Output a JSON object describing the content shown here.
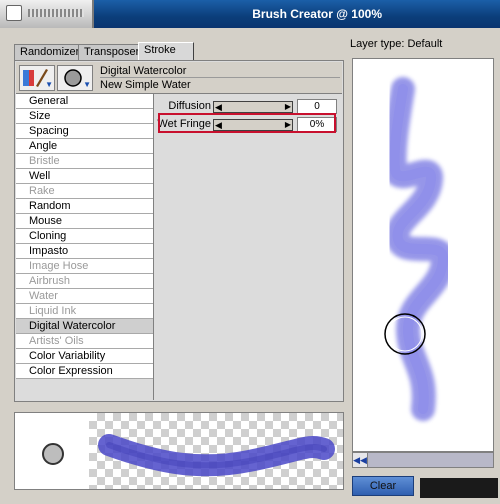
{
  "window": {
    "title": "Brush Creator @ 100%"
  },
  "tabs": [
    {
      "label": "Randomizer"
    },
    {
      "label": "Transposer"
    },
    {
      "label": "Stroke Designer"
    }
  ],
  "brush": {
    "category": "Digital Watercolor",
    "variant": "New Simple Water"
  },
  "categories": [
    {
      "label": "General"
    },
    {
      "label": "Size"
    },
    {
      "label": "Spacing"
    },
    {
      "label": "Angle"
    },
    {
      "label": "Bristle"
    },
    {
      "label": "Well"
    },
    {
      "label": "Rake"
    },
    {
      "label": "Random"
    },
    {
      "label": "Mouse"
    },
    {
      "label": "Cloning"
    },
    {
      "label": "Impasto"
    },
    {
      "label": "Image Hose"
    },
    {
      "label": "Airbrush"
    },
    {
      "label": "Water"
    },
    {
      "label": "Liquid Ink"
    },
    {
      "label": "Digital Watercolor"
    },
    {
      "label": "Artists' Oils"
    },
    {
      "label": "Color Variability"
    },
    {
      "label": "Color Expression"
    }
  ],
  "controls": {
    "diffusion": {
      "label": "Diffusion",
      "value": "0"
    },
    "wet_fringe": {
      "label": "Wet Fringe",
      "value": "0%"
    }
  },
  "canvas": {
    "layer_type": "Layer type: Default",
    "clear_label": "Clear"
  },
  "colors": {
    "stroke": "#5a5ad8",
    "highlight": "#c8102e"
  }
}
